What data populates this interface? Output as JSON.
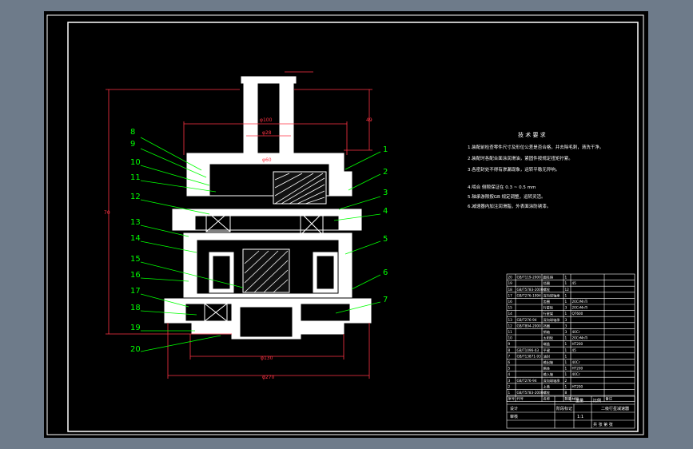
{
  "colors": {
    "background": "#6e7b8a",
    "sheet": "#000000",
    "frame": "#ffffff",
    "leader": "#00ff00",
    "dimension": "#ff3344",
    "label": "#00ff00",
    "section_fill": "#ffffff"
  },
  "part_numbers_left": [
    "8",
    "9",
    "10",
    "11",
    "12",
    "13",
    "14",
    "15",
    "16",
    "17",
    "18",
    "19",
    "20"
  ],
  "part_numbers_right": [
    "1",
    "2",
    "3",
    "4",
    "5",
    "6",
    "7"
  ],
  "dimensions": {
    "top_width": "φ100",
    "shaft_dia": "φ28",
    "inner_dia": "φ60",
    "bottom_a": "φ130",
    "bottom_b": "φ270",
    "height_left": "70",
    "height_right": "49"
  },
  "notes": {
    "heading": "技 术 要 求",
    "items": [
      "1.装配前检查零件尺寸及形位公差是否合格，并去除毛刺，清洗干净。",
      "2.装配时各配合面涂润滑油，紧固件按规定扭矩拧紧。",
      "3.各密封处不得有渗漏现象，运转平稳无异响。",
      "4.啮合 侧隙保证在 0.3 ~ 0.5 mm",
      "5.轴承游隙按GB 规定调整，运转灵活。",
      "6.减速器内加注润滑脂，外表面涂防锈漆。"
    ]
  },
  "bom_rows": [
    {
      "no": "20",
      "code": "GB/T119-2000",
      "name": "圆柱销",
      "qty": "1",
      "mat": "",
      "note": ""
    },
    {
      "no": "19",
      "code": "",
      "name": "挡圈",
      "qty": "1",
      "mat": "45",
      "note": ""
    },
    {
      "no": "18",
      "code": "GB/T5783-2000",
      "name": "螺栓",
      "qty": "12",
      "mat": "",
      "note": ""
    },
    {
      "no": "17",
      "code": "GB/T276-1994",
      "name": "深沟球轴承",
      "qty": "1",
      "mat": "",
      "note": ""
    },
    {
      "no": "16",
      "code": "",
      "name": "齿圈",
      "qty": "1",
      "mat": "20CrMnTi",
      "note": ""
    },
    {
      "no": "15",
      "code": "",
      "name": "行星轮",
      "qty": "3",
      "mat": "20CrMnTi",
      "note": ""
    },
    {
      "no": "14",
      "code": "",
      "name": "行星架",
      "qty": "1",
      "mat": "QT600",
      "note": ""
    },
    {
      "no": "13",
      "code": "GB/T276-94",
      "name": "深沟球轴承",
      "qty": "3",
      "mat": "",
      "note": ""
    },
    {
      "no": "12",
      "code": "GB/T894-2000",
      "name": "挡圈",
      "qty": "3",
      "mat": "",
      "note": ""
    },
    {
      "no": "11",
      "code": "",
      "name": "销轴",
      "qty": "3",
      "mat": "40Cr",
      "note": ""
    },
    {
      "no": "10",
      "code": "",
      "name": "太阳轮",
      "qty": "1",
      "mat": "20CrMnTi",
      "note": ""
    },
    {
      "no": "9",
      "code": "",
      "name": "端盖",
      "qty": "1",
      "mat": "HT200",
      "note": ""
    },
    {
      "no": "8",
      "code": "GB/T1096-03",
      "name": "平键",
      "qty": "1",
      "mat": "45",
      "note": ""
    },
    {
      "no": "7",
      "code": "GB/T13871-93",
      "name": "油封",
      "qty": "1",
      "mat": "",
      "note": ""
    },
    {
      "no": "6",
      "code": "",
      "name": "输出轴",
      "qty": "1",
      "mat": "40Cr",
      "note": ""
    },
    {
      "no": "5",
      "code": "",
      "name": "箱体",
      "qty": "1",
      "mat": "HT200",
      "note": ""
    },
    {
      "no": "4",
      "code": "",
      "name": "输入轴",
      "qty": "1",
      "mat": "40Cr",
      "note": ""
    },
    {
      "no": "3",
      "code": "GB/T276-94",
      "name": "深沟球轴承",
      "qty": "2",
      "mat": "",
      "note": ""
    },
    {
      "no": "2",
      "code": "",
      "name": "上盖",
      "qty": "1",
      "mat": "HT200",
      "note": ""
    },
    {
      "no": "1",
      "code": "GB/T5783-2000",
      "name": "螺栓",
      "qty": "8",
      "mat": "",
      "note": ""
    }
  ],
  "bom_header": {
    "no": "序号",
    "code": "代号",
    "name": "名称",
    "qty": "数量",
    "mat": "材料",
    "note": "备注"
  },
  "title_block": {
    "drawing_name": "二级行星减速器",
    "scale": "1:1",
    "stage_label": "阶段标记",
    "weight_label": "重量",
    "scale_label": "比例",
    "designer": "设计",
    "checker": "审核",
    "sheet_info": "共 张 第 张"
  }
}
